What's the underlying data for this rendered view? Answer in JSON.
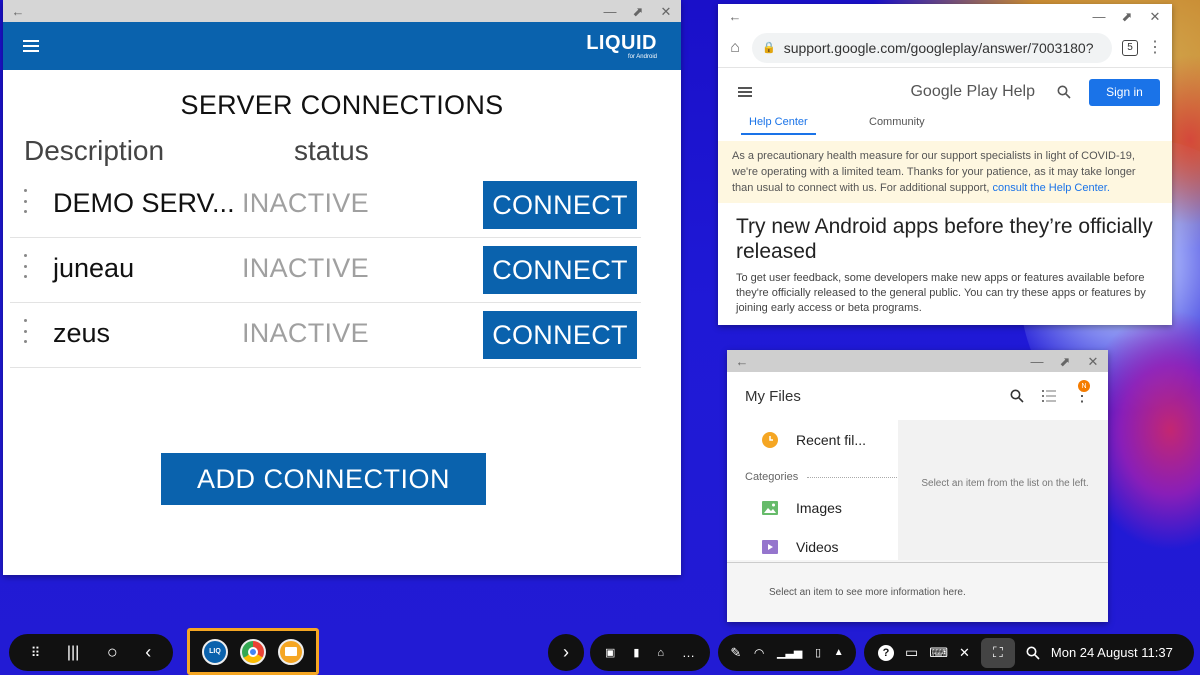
{
  "liquid": {
    "title": "SERVER CONNECTIONS",
    "logo": "LIQUID",
    "logo_sub": "for Android",
    "columns": [
      "Description",
      "status"
    ],
    "rows": [
      {
        "name": "DEMO SERV...",
        "status": "INACTIVE",
        "button": "CONNECT"
      },
      {
        "name": "juneau",
        "status": "INACTIVE",
        "button": "CONNECT"
      },
      {
        "name": "zeus",
        "status": "INACTIVE",
        "button": "CONNECT"
      }
    ],
    "add_button": "ADD CONNECTION",
    "accent": "#0a62ad"
  },
  "chrome": {
    "url": "support.google.com/googleplay/answer/7003180?",
    "tab_count": "5",
    "page_title": "Google Play Help",
    "signin": "Sign in",
    "tabs": [
      "Help Center",
      "Community"
    ],
    "notice_text": "As a precautionary health measure for our support specialists in light of COVID-19, we're operating with a limited team. Thanks for your patience, as it may take longer than usual to connect with us. For additional support, ",
    "notice_link": "consult the Help Center.",
    "heading": "Try new Android apps before they’re officially released",
    "paragraph": "To get user feedback, some developers make new apps or features available before they're officially released to the general public. You can try these apps or features by joining early access or beta programs."
  },
  "files": {
    "title": "My Files",
    "badge": "N",
    "recent": "Recent fil...",
    "categories_label": "Categories",
    "images": "Images",
    "videos": "Videos",
    "right_hint": "Select an item from the list on the left.",
    "footer_hint": "Select an item to see more information here."
  },
  "taskbar": {
    "clock": "Mon 24 August 11:37",
    "apps": [
      "liquid-app-icon",
      "chrome-icon",
      "my-files-icon"
    ]
  }
}
